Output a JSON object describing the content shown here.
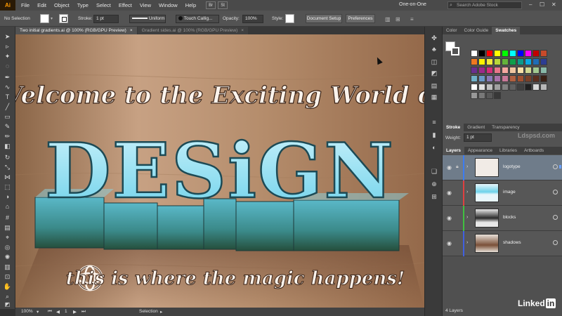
{
  "menubar": {
    "logo": "Ai",
    "items": [
      "File",
      "Edit",
      "Object",
      "Type",
      "Select",
      "Effect",
      "View",
      "Window",
      "Help"
    ],
    "apps": [
      "Br",
      "St"
    ],
    "workspace": "One-on-One",
    "search_placeholder": "Search Adobe Stock",
    "window_controls": [
      "–",
      "☐",
      "✕"
    ]
  },
  "control_bar": {
    "selection_label": "No Selection",
    "stroke_label": "Stroke:",
    "stroke_weight": "1 pt",
    "profile_label": "Uniform",
    "brush_label": "Touch Callig...",
    "opacity_label": "Opacity:",
    "opacity_value": "100%",
    "style_label": "Style:",
    "document_setup": "Document Setup",
    "preferences": "Preferences"
  },
  "doc_tabs": [
    {
      "label": "Two initial gradients.ai @ 100% (RGB/GPU Preview)",
      "active": true
    },
    {
      "label": "Gradient sides.ai @ 100% (RGB/GPU Preview)",
      "active": false
    }
  ],
  "artwork": {
    "headline": "Welcome to the Exciting World of",
    "word": "DESiGN",
    "tagline": "this is where the magic happens!"
  },
  "status_bar": {
    "zoom": "100%",
    "page": "1",
    "mode": "Selection"
  },
  "swatches_panel": {
    "tabs": [
      "Color",
      "Color Guide",
      "Swatches"
    ],
    "active": "Swatches",
    "colors": [
      "#ffffff",
      "#000000",
      "#ff0000",
      "#ffff00",
      "#00ff00",
      "#00ffff",
      "#0000ff",
      "#ff00ff",
      "#c00000",
      "#c84a2a",
      "#f07820",
      "#fff200",
      "#f2ea3a",
      "#b9d739",
      "#64b23b",
      "#0e9e4a",
      "#0d9a8a",
      "#0ba8e0",
      "#1f6db6",
      "#2d3d93",
      "#6a2f8f",
      "#9c2a8a",
      "#d12e7a",
      "#e8768a",
      "#f4a8a0",
      "#f0c6a0",
      "#f8e0a8",
      "#d0d890",
      "#a0c890",
      "#88b8a8",
      "#70b0c8",
      "#6a98c8",
      "#8a7ab8",
      "#a872a8",
      "#c87898",
      "#b06040",
      "#a05030",
      "#7a4028",
      "#5a2e1e",
      "#3a2014",
      "#ffffff",
      "#e0e0e0",
      "#c0c0c0",
      "#a0a0a0",
      "#808080",
      "#606060",
      "#404040",
      "#202020",
      "#d8d8d8",
      "#b8b8b8",
      "#989898",
      "#787878",
      "#585858",
      "#383838"
    ]
  },
  "stroke_panel": {
    "tabs": [
      "Stroke",
      "Gradient",
      "Transparency"
    ],
    "weight_label": "Weight:",
    "weight_value": "1 pt"
  },
  "layers_panel": {
    "tabs": [
      "Layers",
      "Appearance",
      "Libraries",
      "Artboards"
    ],
    "active": "Layers",
    "layers": [
      {
        "name": "logotype",
        "color": "#3d7cf0",
        "selected": true
      },
      {
        "name": "image",
        "color": "#e04040",
        "selected": false
      },
      {
        "name": "blocks",
        "color": "#40c040",
        "selected": false
      },
      {
        "name": "shadows",
        "color": "#4060e0",
        "selected": false
      }
    ],
    "count": "4 Layers"
  },
  "branding": {
    "linkedin_text": "Linked",
    "linkedin_in": "in",
    "watermark": "Ldspsd.com"
  }
}
